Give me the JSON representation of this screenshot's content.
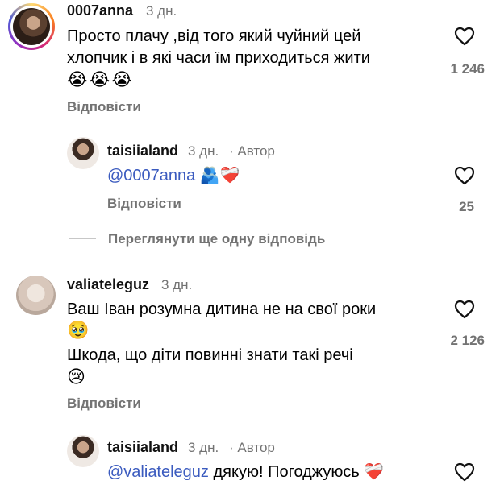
{
  "comments": [
    {
      "username": "0007anna",
      "time": "3 дн.",
      "text_line1": "Просто плачу ,від того який чуйний цей",
      "text_line2": "хлопчик і в які часи їм приходиться жити",
      "emoji_line": "😭😭😭",
      "likes": "1 246",
      "reply_label": "Відповісти"
    },
    {
      "username": "taisiialand",
      "time": "3 дн.",
      "author_tag": "· Автор",
      "mention": "@0007anna",
      "emoji": "🫂❤️‍🩹",
      "likes": "25",
      "reply_label": "Відповісти"
    },
    {
      "view_more": "Переглянути ще одну відповідь"
    },
    {
      "username": "valiateleguz",
      "time": "3 дн.",
      "text_line1": "Ваш Іван розумна дитина не на свої роки",
      "emoji_line1": "🥹",
      "text_line2": "Шкода, що діти повинні знати такі речі",
      "emoji_line2": "😢",
      "likes": "2 126",
      "reply_label": "Відповісти"
    },
    {
      "username": "taisiialand",
      "time": "3 дн.",
      "author_tag": "· Автор",
      "mention": "@valiateleguz",
      "text": "дякую! Погоджуюсь",
      "emoji": "❤️‍🩹"
    }
  ],
  "colors": {
    "secondary": "#737373",
    "mention": "#3b5bbf",
    "ring": "#d62976"
  },
  "icons": [
    "heart-outline-icon"
  ]
}
